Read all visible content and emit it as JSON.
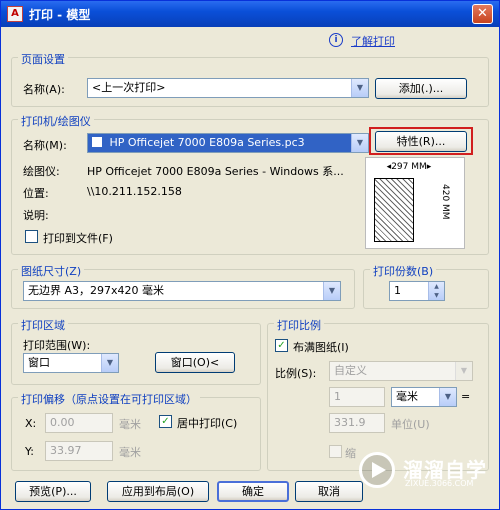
{
  "window": {
    "title": "打印 - 模型",
    "app_icon": "autocad-icon",
    "close_label": "✕",
    "help_text": "了解打印"
  },
  "page_setup": {
    "legend": "页面设置",
    "name_label": "名称(A):",
    "name_value": "<上一次打印>",
    "add_button": "添加(.)..."
  },
  "printer": {
    "legend": "打印机/绘图仪",
    "name_label": "名称(M):",
    "name_value": "HP Officejet 7000 E809a Series.pc3",
    "properties_button": "特性(R)...",
    "plotter_label": "绘图仪:",
    "plotter_value": "HP Officejet 7000 E809a Series - Windows 系...",
    "location_label": "位置:",
    "location_value": "\\\\10.211.152.158",
    "description_label": "说明:",
    "print_to_file_label": "打印到文件(F)",
    "print_to_file_checked": false,
    "preview_width": "297 MM",
    "preview_height": "420 MM"
  },
  "paper_size": {
    "legend": "图纸尺寸(Z)",
    "value": "无边界 A3，297x420 毫米"
  },
  "copies": {
    "legend": "打印份数(B)",
    "value": "1"
  },
  "plot_area": {
    "legend": "打印区域",
    "range_label": "打印范围(W):",
    "range_value": "窗口",
    "window_button": "窗口(O)<"
  },
  "plot_scale": {
    "legend": "打印比例",
    "fit_label": "布满图纸(I)",
    "fit_checked": true,
    "scale_label": "比例(S):",
    "scale_value": "自定义",
    "value1": "1",
    "unit_value": "毫米",
    "equals": "=",
    "value2": "331.9",
    "unit_label": "单位(U)",
    "scale_lineweights_label": "缩"
  },
  "plot_offset": {
    "legend": "打印偏移（原点设置在可打印区域）",
    "x_label": "X:",
    "x_value": "0.00",
    "x_unit": "毫米",
    "y_label": "Y:",
    "y_value": "33.97",
    "y_unit": "毫米",
    "center_label": "居中打印(C)",
    "center_checked": true
  },
  "buttons": {
    "preview": "预览(P)...",
    "apply_layout": "应用到布局(O)",
    "ok": "确定",
    "cancel": "取消"
  },
  "watermark": {
    "brand": "溜溜自学",
    "site": "ZIXUE.3066.COM"
  }
}
